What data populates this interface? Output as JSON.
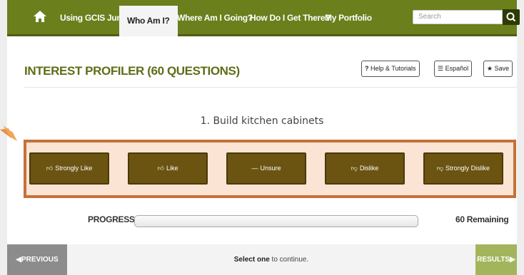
{
  "nav": {
    "items": [
      "Using GCIS Junior",
      "Who Am I?",
      "Where Am I Going?",
      "How Do I Get There?",
      "My Portfolio"
    ],
    "search_placeholder": "Search"
  },
  "page": {
    "title": "INTEREST PROFILER (60 QUESTIONS)",
    "help": "Help & Tutorials",
    "espanol": "Español",
    "save": "Save"
  },
  "question": {
    "text": "1. Build kitchen cabinets"
  },
  "answers": [
    "Strongly Like",
    "Like",
    "Unsure",
    "Dislike",
    "Strongly Dislike"
  ],
  "progress": {
    "label": "PROGRESS",
    "percent": 0,
    "remaining": "60 Remaining"
  },
  "footer": {
    "previous": "PREVIOUS",
    "status_strong": "Select one",
    "status_rest": " to continue.",
    "results": "RESULTS"
  },
  "colors": {
    "nav": "#6b7f1c",
    "answer_button": "#6b5312",
    "highlight_border": "#c4713a",
    "highlight_fill": "#fbe4d4"
  }
}
